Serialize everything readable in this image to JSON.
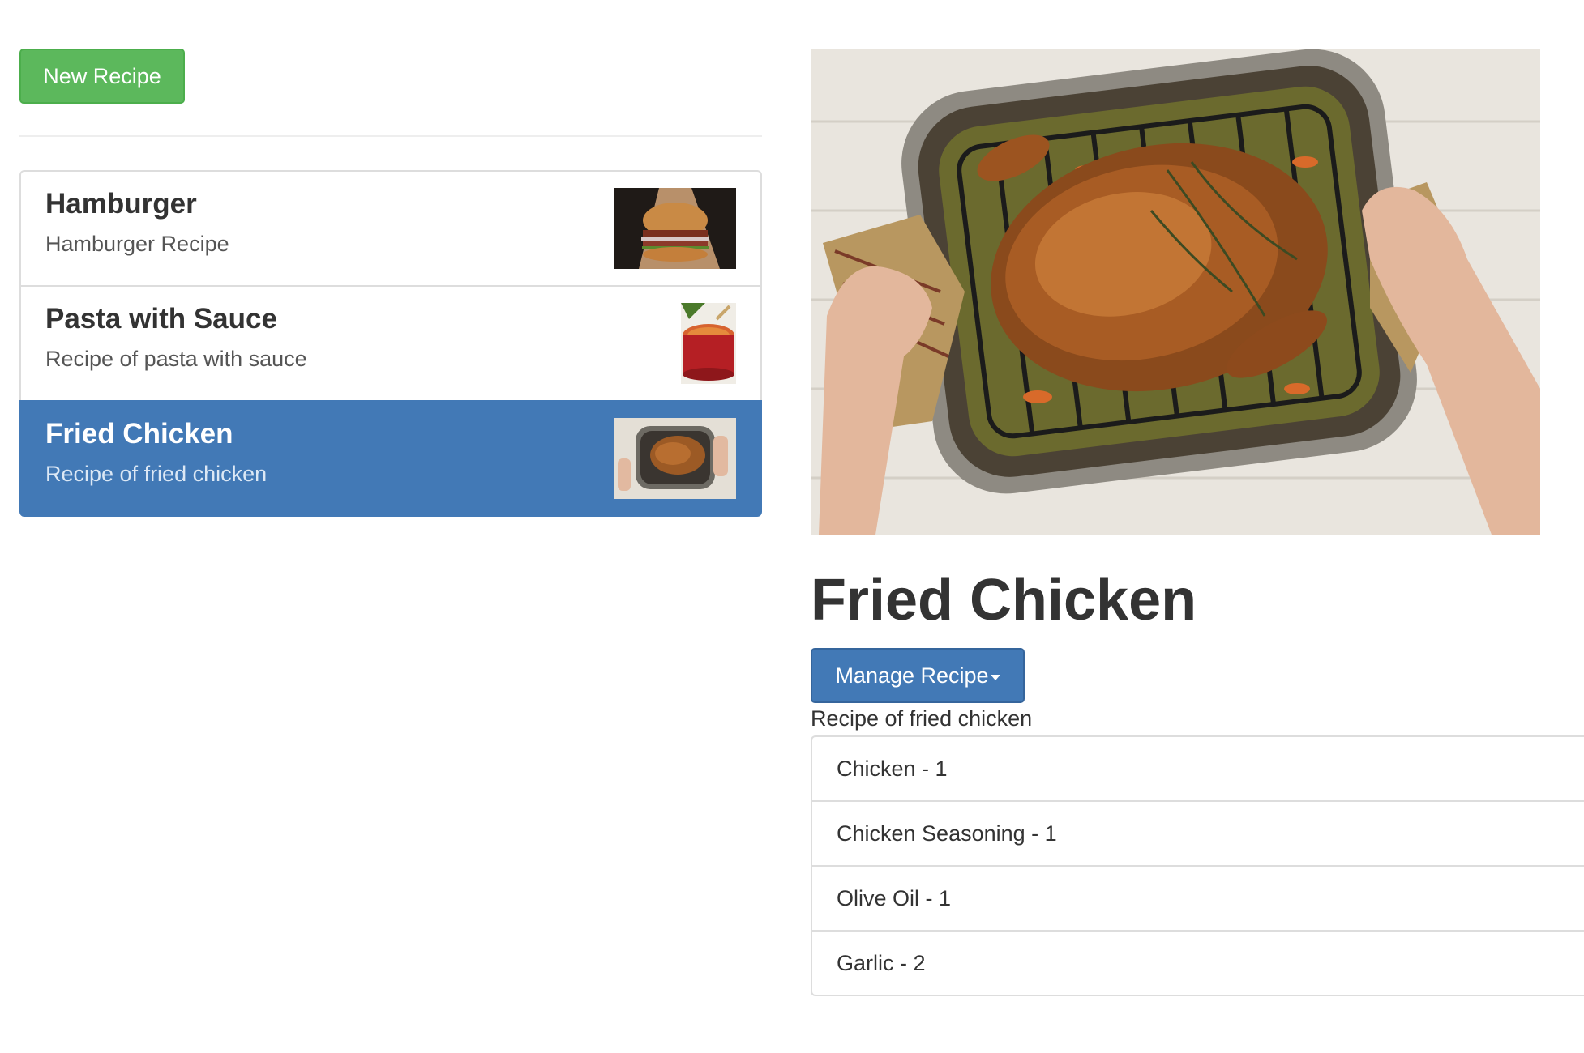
{
  "toolbar": {
    "new_recipe_label": "New Recipe"
  },
  "recipes": [
    {
      "name": "Hamburger",
      "description": "Hamburger Recipe",
      "image": "hamburger-photo",
      "active": false
    },
    {
      "name": "Pasta with Sauce",
      "description": "Recipe of pasta with sauce",
      "image": "pasta-pot-photo",
      "active": false
    },
    {
      "name": "Fried Chicken",
      "description": "Recipe of fried chicken",
      "image": "roast-chicken-photo",
      "active": true
    }
  ],
  "detail": {
    "image": "roast-chicken-photo",
    "title": "Fried Chicken",
    "manage_label": "Manage Recipe",
    "description": "Recipe of fried chicken",
    "ingredients": [
      {
        "label": "Chicken - 1"
      },
      {
        "label": "Chicken Seasoning - 1"
      },
      {
        "label": "Olive Oil - 1"
      },
      {
        "label": "Garlic - 2"
      }
    ]
  },
  "colors": {
    "success": "#5cb85c",
    "primary": "#4279b6",
    "border": "#dddddd"
  }
}
